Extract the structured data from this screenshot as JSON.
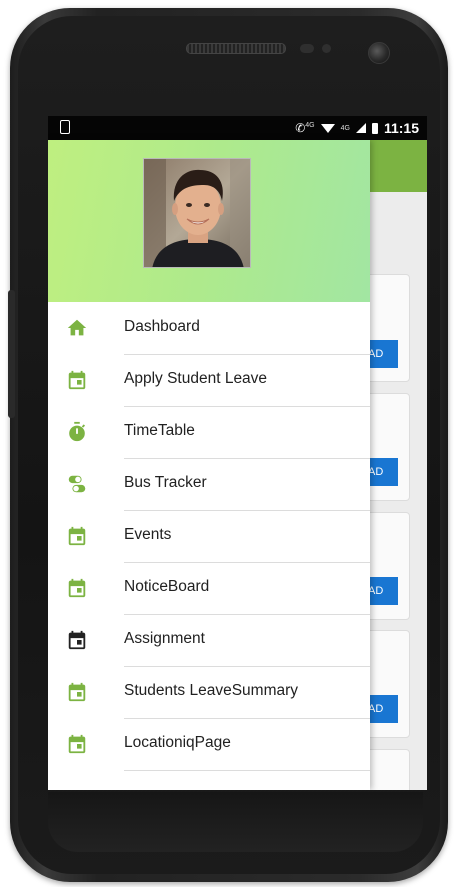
{
  "status_bar": {
    "time": "11:15",
    "network_call": "4G",
    "network_data": "4G"
  },
  "background_app": {
    "button_fragment": "AD",
    "accent": "#7cb342",
    "button_color": "#1976d2"
  },
  "drawer": {
    "header_gradient": [
      "#bfef80",
      "#a2e6a2"
    ],
    "avatar": "profile-photo",
    "items": [
      {
        "label": "Dashboard",
        "icon": "home-icon",
        "color": "#7cb342"
      },
      {
        "label": "Apply Student Leave",
        "icon": "calendar-icon",
        "color": "#7cb342"
      },
      {
        "label": "TimeTable",
        "icon": "timer-icon",
        "color": "#7cb342"
      },
      {
        "label": "Bus Tracker",
        "icon": "toggles-icon",
        "color": "#7cb342"
      },
      {
        "label": "Events",
        "icon": "calendar-icon",
        "color": "#7cb342"
      },
      {
        "label": "NoticeBoard",
        "icon": "calendar-icon",
        "color": "#7cb342"
      },
      {
        "label": "Assignment",
        "icon": "calendar-icon",
        "color": "#222222"
      },
      {
        "label": "Students LeaveSummary",
        "icon": "calendar-icon",
        "color": "#7cb342"
      },
      {
        "label": "LocationiqPage",
        "icon": "calendar-icon",
        "color": "#7cb342"
      }
    ]
  }
}
